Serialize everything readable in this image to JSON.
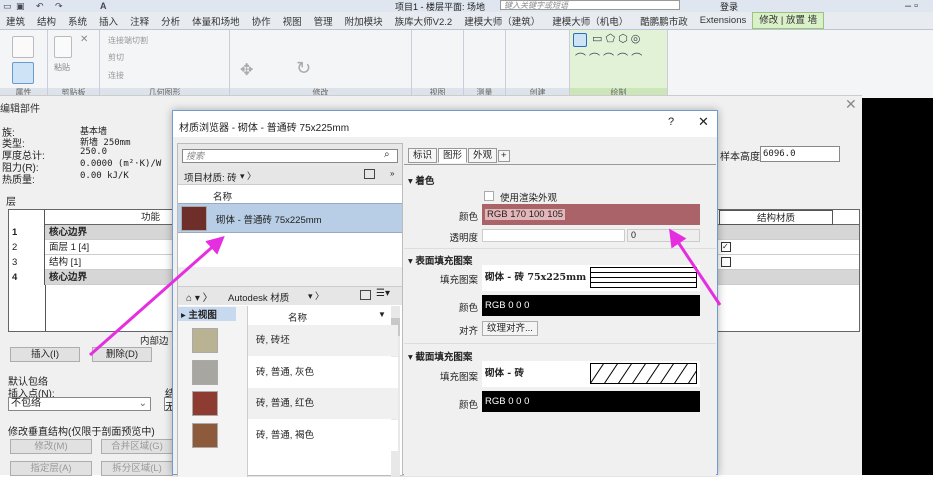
{
  "app": {
    "doc_title": "项目1 - 楼层平面: 场地",
    "help_search_placeholder": "键入关键字或短语",
    "login": "登录"
  },
  "tabs": [
    "建筑",
    "结构",
    "系统",
    "插入",
    "注释",
    "分析",
    "体量和场地",
    "协作",
    "视图",
    "管理",
    "附加模块",
    "族库大师V2.2",
    "建模大师（建筑）",
    "建模大师（机电）",
    "酷鹏鹏市政",
    "Extensions",
    "修改 | 放置 墙"
  ],
  "ribbon": {
    "panels": [
      "属性",
      "剪贴板",
      "几何图形",
      "修改",
      "视图",
      "测量",
      "创建",
      "绘制"
    ],
    "buttons": {
      "paste": "粘贴",
      "cut_join": "连接端切割",
      "cut": "剪切",
      "join": "连接"
    }
  },
  "edit_assembly": {
    "title": "编辑部件",
    "info": [
      {
        "label": "族:",
        "value": "基本墙"
      },
      {
        "label": "类型:",
        "value": "新墙 250mm"
      },
      {
        "label": "厚度总计:",
        "value": "250.0"
      },
      {
        "label": "阻力(R):",
        "value": "0.0000 (m²·K)/W"
      },
      {
        "label": "热质量:",
        "value": "0.00 kJ/K"
      }
    ],
    "sample_height_label": "样本高度(S):",
    "sample_height": "6096.0",
    "layers_label": "层",
    "columns": {
      "function": "功能",
      "structural_material": "结构材质"
    },
    "rows": [
      {
        "n": "1",
        "f": "核心边界",
        "core": true
      },
      {
        "n": "2",
        "f": "面层 1 [4]",
        "checked": true
      },
      {
        "n": "3",
        "f": "结构 [1]",
        "checked": false
      },
      {
        "n": "4",
        "f": "核心边界",
        "core": true
      }
    ],
    "inner_edge": "内部边",
    "insert": "插入(I)",
    "delete": "删除(D)",
    "default_wrap": "默认包络",
    "insert_point": "插入点(N):",
    "insert_point_value": "不包络",
    "end_point_short": "结",
    "end_point_value_short": "无",
    "modify_vertical": "修改垂直结构(仅限于剖面预览中)",
    "modify": "修改(M)",
    "merge": "合并区域(G)",
    "assign": "指定层(A)",
    "split": "拆分区域(L)"
  },
  "material_browser": {
    "title": "材质浏览器 - 砌体 - 普通砖 75x225mm",
    "help": "?",
    "search_placeholder": "搜索",
    "project_filter": "项目材质: 砖",
    "name_header": "名称",
    "project_materials": [
      "砌体 - 普通砖 75x225mm"
    ],
    "library": "Autodesk 材质",
    "tree_home": "主视图",
    "library_items": [
      {
        "name": "砖, 砖坯",
        "color": "#b9b393"
      },
      {
        "name": "砖, 普通, 灰色",
        "color": "#a8a6a0"
      },
      {
        "name": "砖, 普通, 红色",
        "color": "#8e3b32"
      },
      {
        "name": "砖, 普通, 褐色",
        "color": "#8d5a3c"
      }
    ],
    "tabs": [
      "标识",
      "图形",
      "外观",
      "+"
    ],
    "shading": {
      "title": "着色",
      "use_render": "使用渲染外观",
      "color_label": "颜色",
      "color": "RGB 170 100 105",
      "color_hex": "#aa6469",
      "transparency_label": "透明度",
      "transparency": "0"
    },
    "surface": {
      "title": "表面填充图案",
      "pattern_label": "填充图案",
      "pattern": "砌体 - 砖 75x225mm",
      "color_label": "颜色",
      "color": "RGB 0 0 0",
      "align_label": "对齐",
      "align": "纹理对齐..."
    },
    "cut": {
      "title": "截面填充图案",
      "pattern_label": "填充图案",
      "pattern": "砌体 - 砖",
      "color_label": "颜色",
      "color": "RGB 0 0 0"
    }
  },
  "annotation_color": "#e52ee0"
}
